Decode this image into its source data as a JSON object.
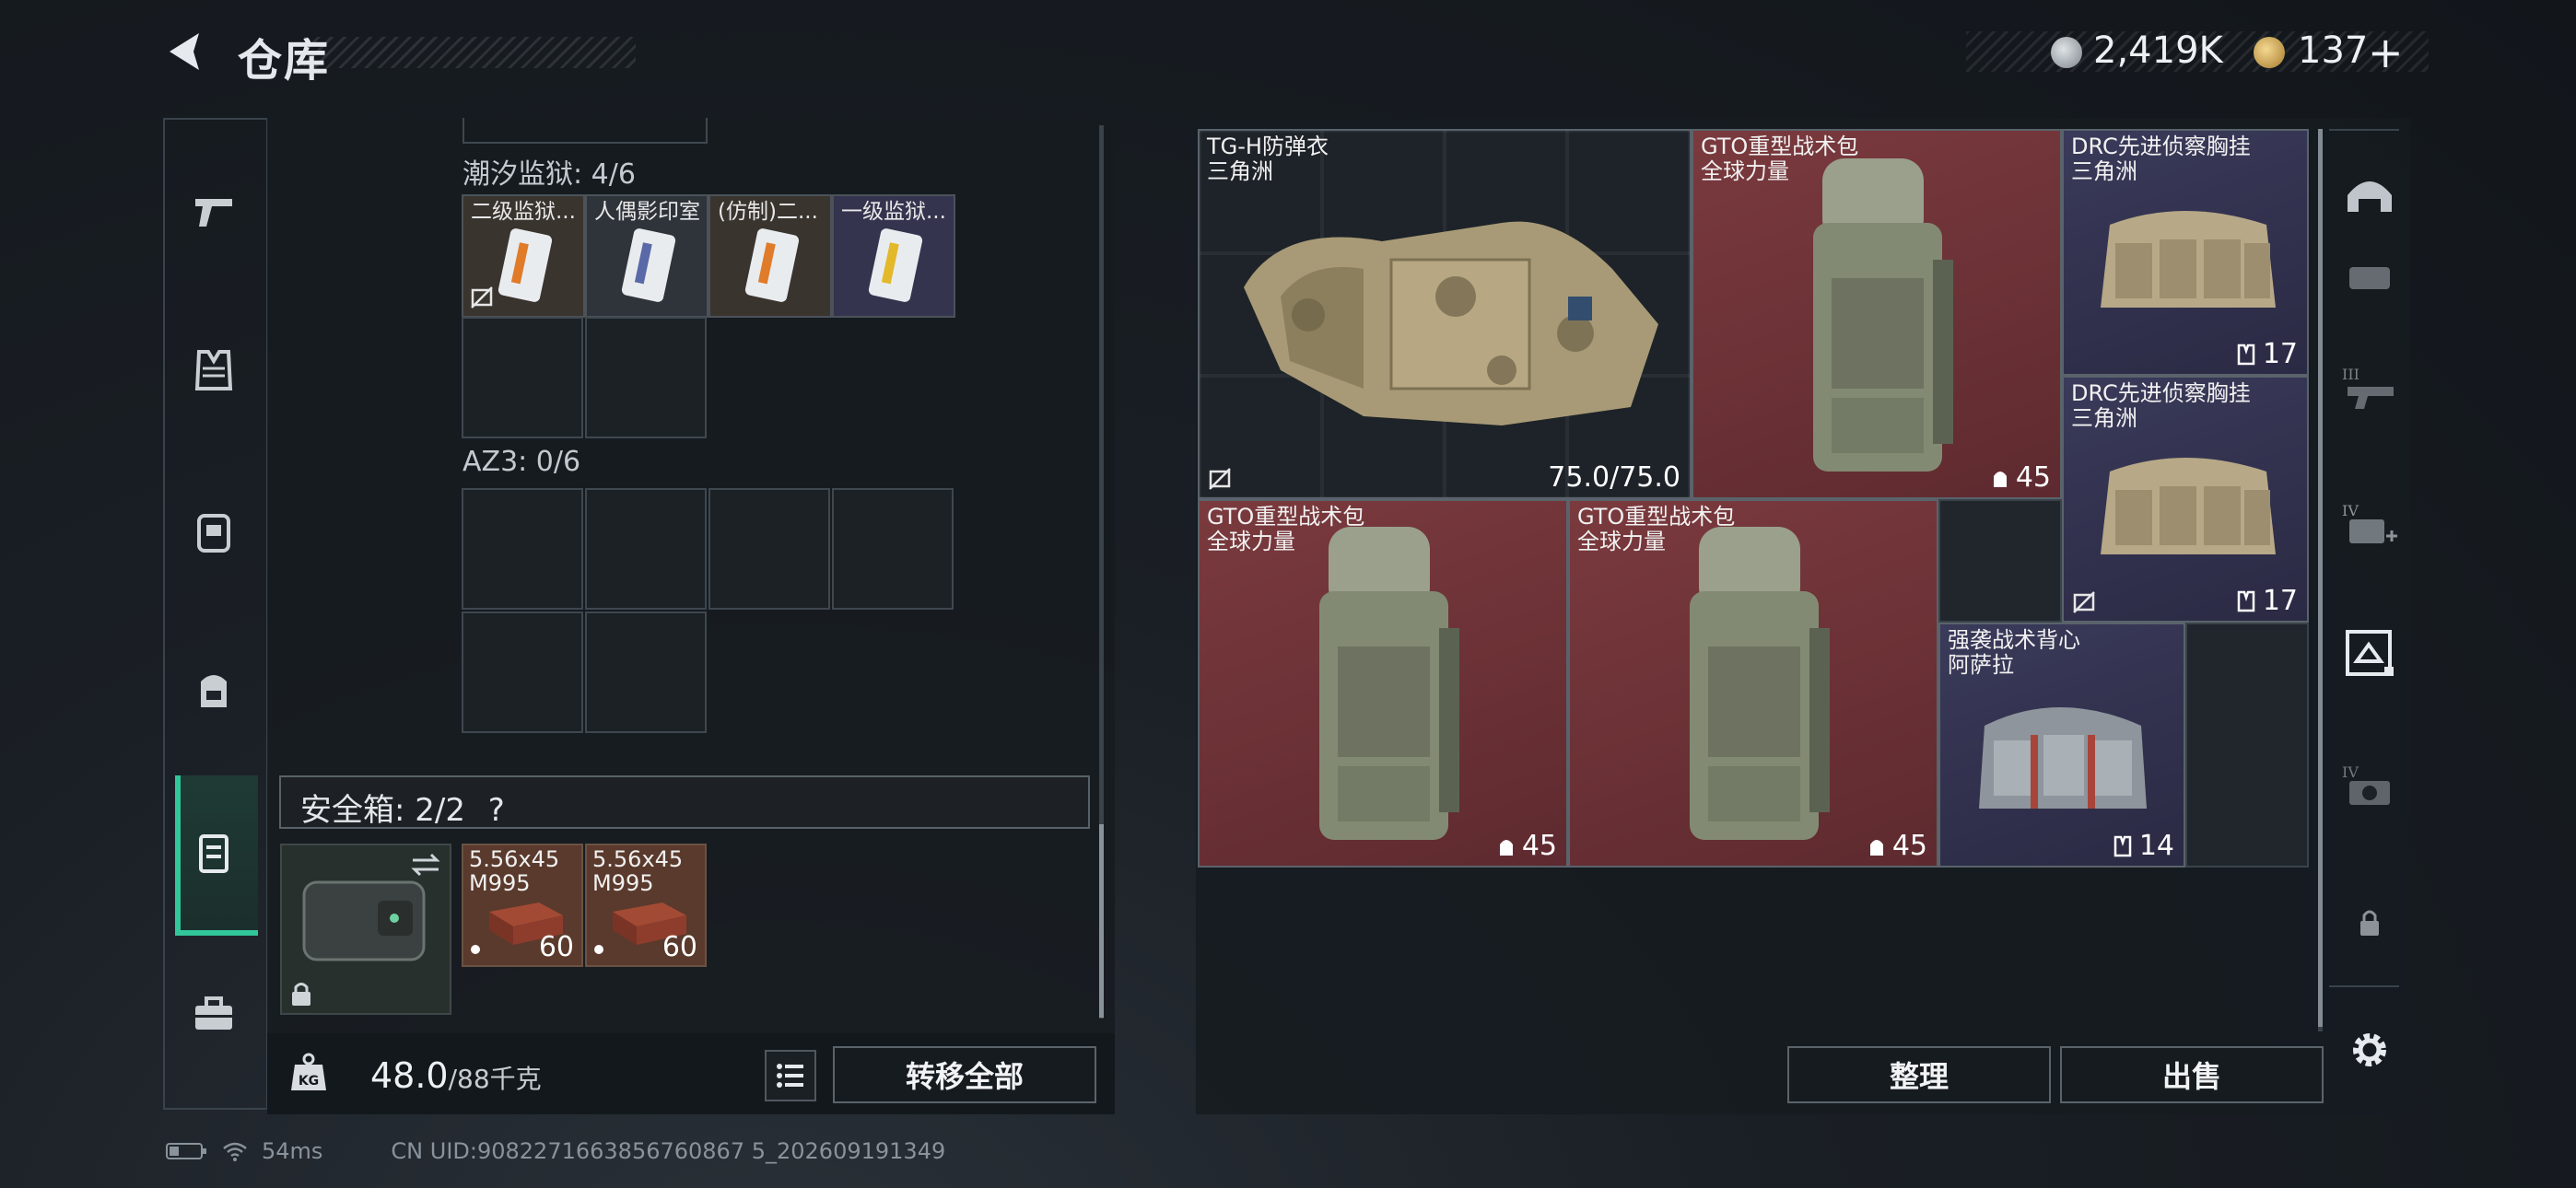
{
  "header": {
    "title": "仓库",
    "currency1_value": "2,419K",
    "currency2_value": "137",
    "currency2_add": "+"
  },
  "left_nav": {
    "items": [
      {
        "icon": "pistol-icon"
      },
      {
        "icon": "armor-icon"
      },
      {
        "icon": "chest-rig-icon"
      },
      {
        "icon": "backpack-icon"
      },
      {
        "icon": "secure-case-icon",
        "active": true
      },
      {
        "icon": "toolbox-icon"
      }
    ]
  },
  "left_panel": {
    "section1": {
      "label": "潮汐监狱: 4/6",
      "items": [
        "二级监狱...",
        "人偶影印室",
        "(仿制)二...",
        "一级监狱..."
      ]
    },
    "section2": {
      "label": "AZ3: 0/6"
    },
    "safe_box": {
      "label": "安全箱: 2/2",
      "help": "?",
      "ammo": [
        {
          "name_line1": "5.56x45",
          "name_line2": "M995",
          "count": "60"
        },
        {
          "name_line1": "5.56x45",
          "name_line2": "M995",
          "count": "60"
        }
      ]
    },
    "weight": {
      "value": "48.0",
      "max": "/88千克",
      "transfer_all": "转移全部"
    }
  },
  "right_panel": {
    "items": [
      {
        "name": "TG-H防弹衣",
        "sub": "三角洲",
        "value": "75.0/75.0"
      },
      {
        "name": "GTO重型战术包",
        "sub": "全球力量",
        "value": "45"
      },
      {
        "name": "DRC先进侦察胸挂",
        "sub": "三角洲",
        "value": "17"
      },
      {
        "name": "DRC先进侦察胸挂",
        "sub": "三角洲",
        "value": "17"
      },
      {
        "name": "GTO重型战术包",
        "sub": "全球力量",
        "value": "45"
      },
      {
        "name": "GTO重型战术包",
        "sub": "全球力量",
        "value": "45"
      },
      {
        "name": "强袭战术背心",
        "sub": "阿萨拉",
        "value": "14"
      }
    ],
    "sort_button": "整理",
    "sell_button": "出售"
  },
  "right_nav": {
    "items": [
      "helmet-icon",
      "tier-i-rig-icon",
      "tier-iii-weapon-icon",
      "tier-iv-med-icon",
      "selected-gallery-icon",
      "tier-iv-gear-icon",
      "lock-icon",
      "settings-icon"
    ]
  },
  "status_bar": {
    "ping": "54ms",
    "uid": "CN UID:9082271663856760867 5_202609191349"
  },
  "colors": {
    "accent": "#31c79a",
    "red_item": "#7a3a3e",
    "blue_item": "#2a4354",
    "purple_item": "#3a3a5a"
  }
}
